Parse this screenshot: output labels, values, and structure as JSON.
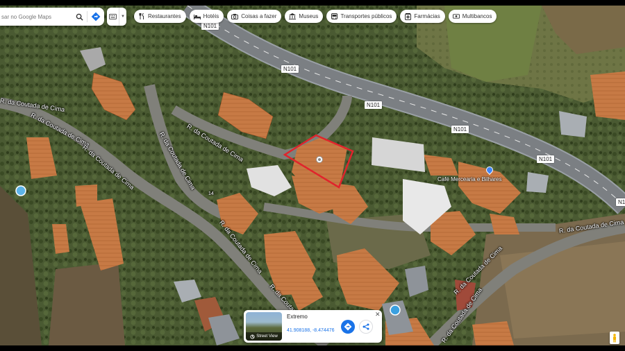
{
  "search": {
    "placeholder": "sar no Google Maps"
  },
  "chips": [
    {
      "label": "Restaurantes",
      "icon": "fork-knife-icon"
    },
    {
      "label": "Hotéis",
      "icon": "bed-icon"
    },
    {
      "label": "Coisas a fazer",
      "icon": "camera-icon"
    },
    {
      "label": "Museus",
      "icon": "museum-icon"
    },
    {
      "label": "Transportes públicos",
      "icon": "bus-icon"
    },
    {
      "label": "Farmácias",
      "icon": "pharmacy-icon"
    },
    {
      "label": "Multibancos",
      "icon": "atm-icon"
    }
  ],
  "roads": {
    "n101_1": "N101",
    "n101_2": "N101",
    "n101_3": "N101",
    "n101_4": "N101",
    "n101_5": "N101",
    "n101_6": "N10",
    "coutada_1": "R. da Coutada de Cima",
    "coutada_2": "R. da Coutada de Cima",
    "coutada_3": "R. da Coutada de Cima",
    "coutada_4": "R. da Coutada de Cima",
    "coutada_5": "R. da Coutada de Cima",
    "coutada_6": "R. da Coutada de Cima",
    "coutada_7": "R. da Coutada de Cima",
    "coutada_8": "R. da Coutada de Cima",
    "coutada_9": "R. da Coutada de Cima",
    "coutada_west": "R. da Coutada de Cima",
    "house_number": "14"
  },
  "poi": {
    "label": "Café Mercearia e Bilhares"
  },
  "card": {
    "title": "Extremo",
    "coords": "41.908188, -8.474476",
    "streetview_label": "Street View"
  },
  "colors": {
    "accent": "#1a73e8",
    "selection": "#e0242c"
  }
}
